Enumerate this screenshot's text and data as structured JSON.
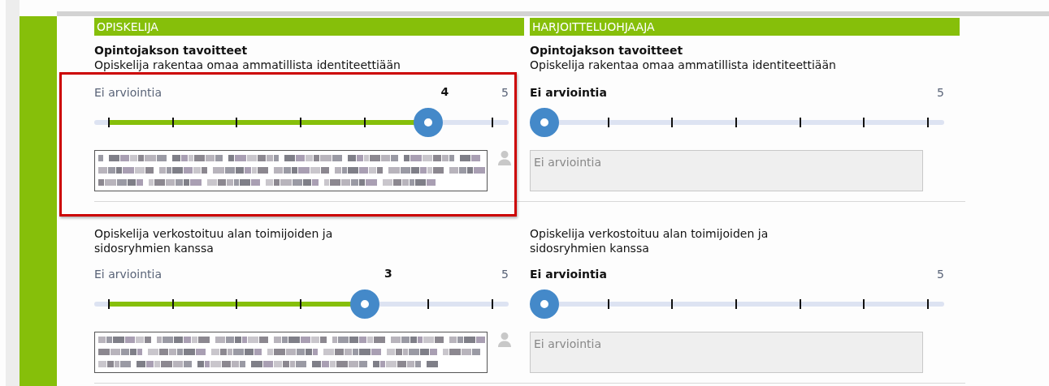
{
  "columns": [
    {
      "heading": "OPISKELIJA"
    },
    {
      "heading": "HARJOITTELUOHJAAJA"
    }
  ],
  "rows": [
    {
      "highlighted": true,
      "cells": [
        {
          "title": "Opintojakson tavoitteet",
          "goal": "Opiskelija rakentaa omaa ammatillista identiteettiään",
          "scale": {
            "min_label": "Ei arviointia",
            "value_label": "4",
            "max_label": "5",
            "level": 0.833
          },
          "comment": {
            "kind": "redacted",
            "disabled": false
          }
        },
        {
          "title": "Opintojakson tavoitteet",
          "goal": "Opiskelija rakentaa omaa ammatillista identiteettiään",
          "scale": {
            "min_label": "Ei arviointia",
            "max_label": "5",
            "level": 0
          },
          "comment": {
            "kind": "text",
            "text": "Ei arviointia",
            "disabled": true
          }
        }
      ]
    },
    {
      "highlighted": false,
      "cells": [
        {
          "goal": "Opiskelija verkostoituu alan toimijoiden ja sidosryhmien kanssa",
          "scale": {
            "min_label": "Ei arviointia",
            "value_label": "3",
            "max_label": "5",
            "level": 0.667
          },
          "comment": {
            "kind": "redacted",
            "disabled": false
          }
        },
        {
          "goal": "Opiskelija verkostoituu alan toimijoiden ja sidosryhmien kanssa",
          "scale": {
            "min_label": "Ei arviointia",
            "max_label": "5",
            "level": 0
          },
          "comment": {
            "kind": "text",
            "text": "Ei arviointia",
            "disabled": true
          }
        }
      ]
    }
  ]
}
